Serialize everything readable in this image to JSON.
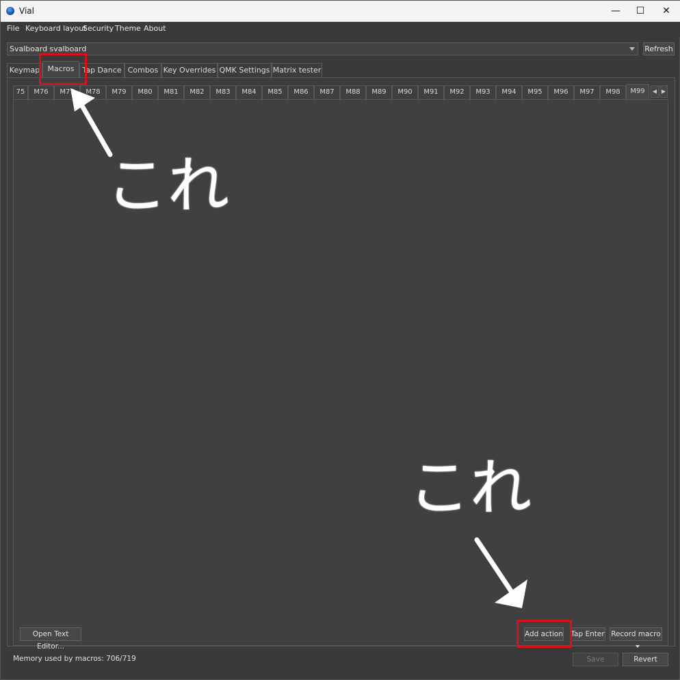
{
  "window": {
    "title": "Vial",
    "minimize_glyph": "—",
    "maximize_glyph": "☐",
    "close_glyph": "✕"
  },
  "menu": [
    "File",
    "Keyboard layout",
    "Security",
    "Theme",
    "About"
  ],
  "device": {
    "selected": "Svalboard svalboard",
    "refresh_label": "Refresh"
  },
  "main_tabs": [
    "Keymap",
    "Macros",
    "Tap Dance",
    "Combos",
    "Key Overrides",
    "QMK Settings",
    "Matrix tester"
  ],
  "active_main_tab": "Macros",
  "macro_tabs": [
    "75",
    "M76",
    "M77",
    "M78",
    "M79",
    "M80",
    "M81",
    "M82",
    "M83",
    "M84",
    "M85",
    "M86",
    "M87",
    "M88",
    "M89",
    "M90",
    "M91",
    "M92",
    "M93",
    "M94",
    "M95",
    "M96",
    "M97",
    "M98",
    "M99"
  ],
  "active_macro_tab": "M99",
  "scroll": {
    "left": "◀",
    "right": "▶"
  },
  "editor": {
    "open_text_editor": "Open Text Editor...",
    "add_action": "Add action",
    "tap_enter": "Tap Enter",
    "record_macro": "Record macro"
  },
  "footer": {
    "memory": "Memory used by macros: 706/719",
    "save": "Save",
    "revert": "Revert"
  },
  "annotations": {
    "top_label": "これ",
    "bottom_label": "これ",
    "highlight_color": "#d8101a"
  }
}
